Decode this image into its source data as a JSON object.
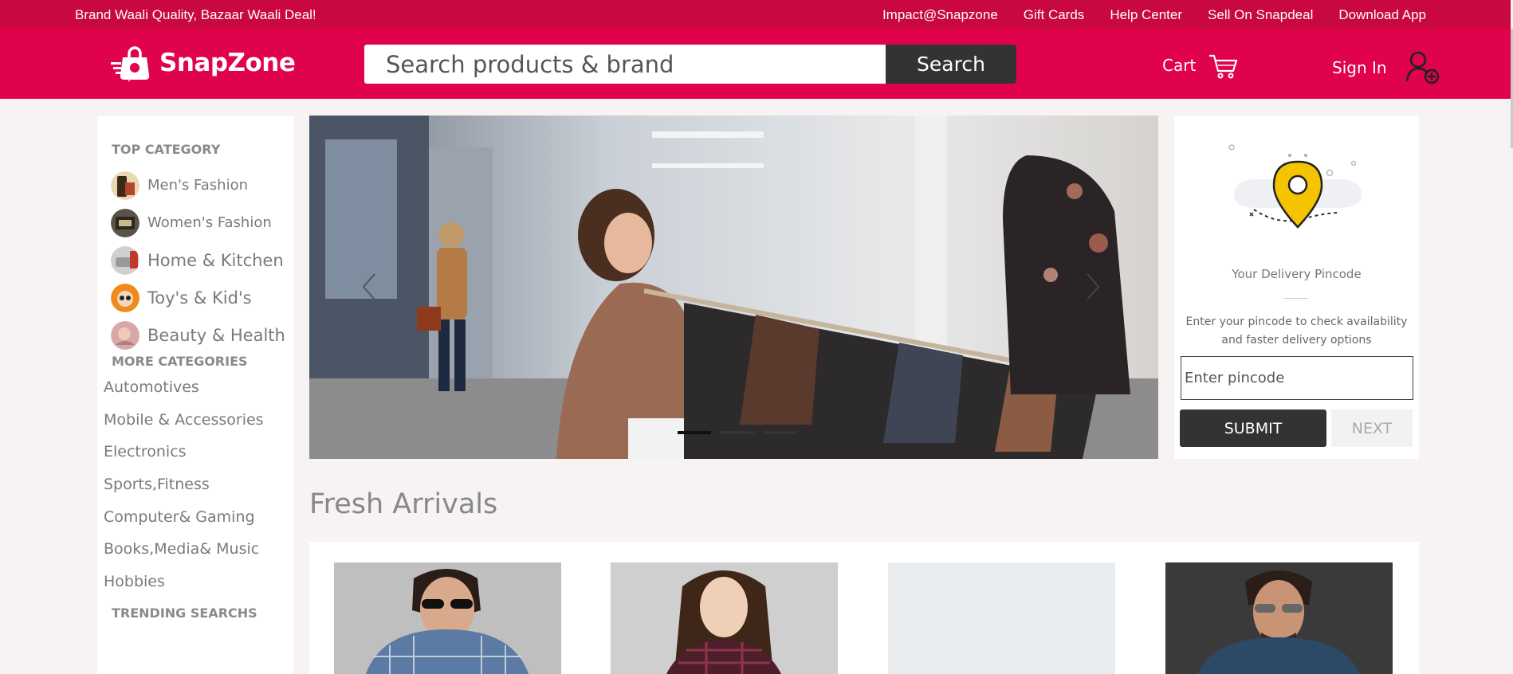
{
  "topbar": {
    "tagline": "Brand Waali Quality, Bazaar Waali Deal!",
    "links": [
      "Impact@Snapzone",
      "Gift Cards",
      "Help Center",
      "Sell On Snapdeal",
      "Download App"
    ]
  },
  "header": {
    "logo_text": "SnapZone",
    "search_placeholder": "Search products & brand",
    "search_button": "Search",
    "cart_label": "Cart",
    "signin_label": "Sign In"
  },
  "sidebar": {
    "top_heading": "TOP CATEGORY",
    "top_categories": [
      "Men's Fashion",
      "Women's Fashion",
      "Home & Kitchen",
      "Toy's & Kid's",
      "Beauty & Health"
    ],
    "more_heading": "MORE CATEGORIES",
    "more_categories": [
      "Automotives",
      "Mobile & Accessories",
      "Electronics",
      "Sports,Fitness",
      "Computer& Gaming",
      "Books,Media& Music",
      "Hobbies"
    ],
    "trending_heading": "TRENDING SEARCHS"
  },
  "carousel": {
    "slide_count": 3,
    "active_index": 0,
    "scene": "woman shopping at clothing rack"
  },
  "pincode": {
    "icon": "location-pin-icon",
    "title": "Your Delivery Pincode",
    "description": "Enter your pincode to check availability and faster delivery options",
    "placeholder": "Enter pincode",
    "submit_label": "SUBMIT",
    "next_label": "NEXT"
  },
  "fresh_arrivals": {
    "title": "Fresh Arrivals",
    "products": [
      {
        "name": "man-blue-checked-shirt"
      },
      {
        "name": "woman-red-checked-shirt"
      },
      {
        "name": "blank-placeholder"
      },
      {
        "name": "man-denim-shirt"
      }
    ]
  },
  "colors": {
    "brand": "#e0024a",
    "topbar": "#c8083f",
    "dark_button": "#333333",
    "page_bg": "#f7f3f2"
  }
}
